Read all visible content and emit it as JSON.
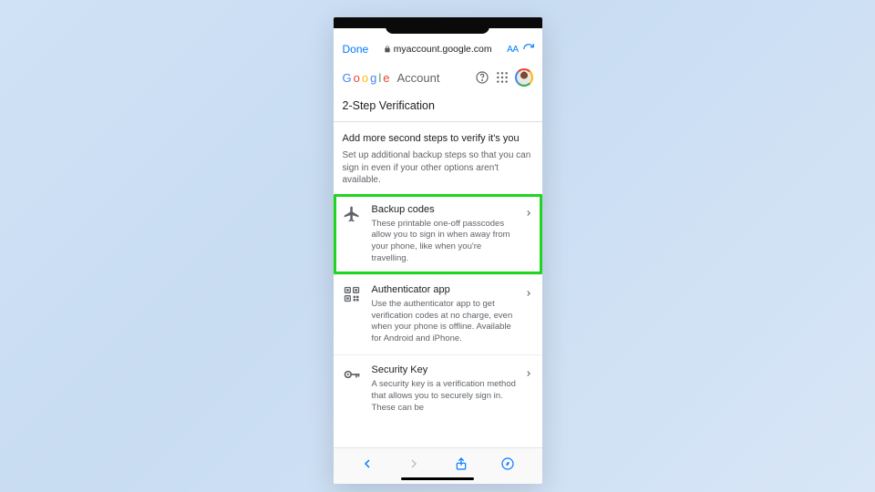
{
  "browser": {
    "done": "Done",
    "domain": "myaccount.google.com",
    "text_size": "AA"
  },
  "header": {
    "brand": "Google",
    "product": "Account"
  },
  "page": {
    "title": "2-Step Verification",
    "section_heading": "Add more second steps to verify it's you",
    "section_sub": "Set up additional backup steps so that you can sign in even if your other options aren't available."
  },
  "options": [
    {
      "title": "Backup codes",
      "desc": "These printable one-off passcodes allow you to sign in when away from your phone, like when you're travelling.",
      "highlight": true,
      "icon": "airplane"
    },
    {
      "title": "Authenticator app",
      "desc": "Use the authenticator app to get verification codes at no charge, even when your phone is offline. Available for Android and iPhone.",
      "highlight": false,
      "icon": "qr"
    },
    {
      "title": "Security Key",
      "desc": "A security key is a verification method that allows you to securely sign in. These can be",
      "highlight": false,
      "icon": "key"
    }
  ]
}
